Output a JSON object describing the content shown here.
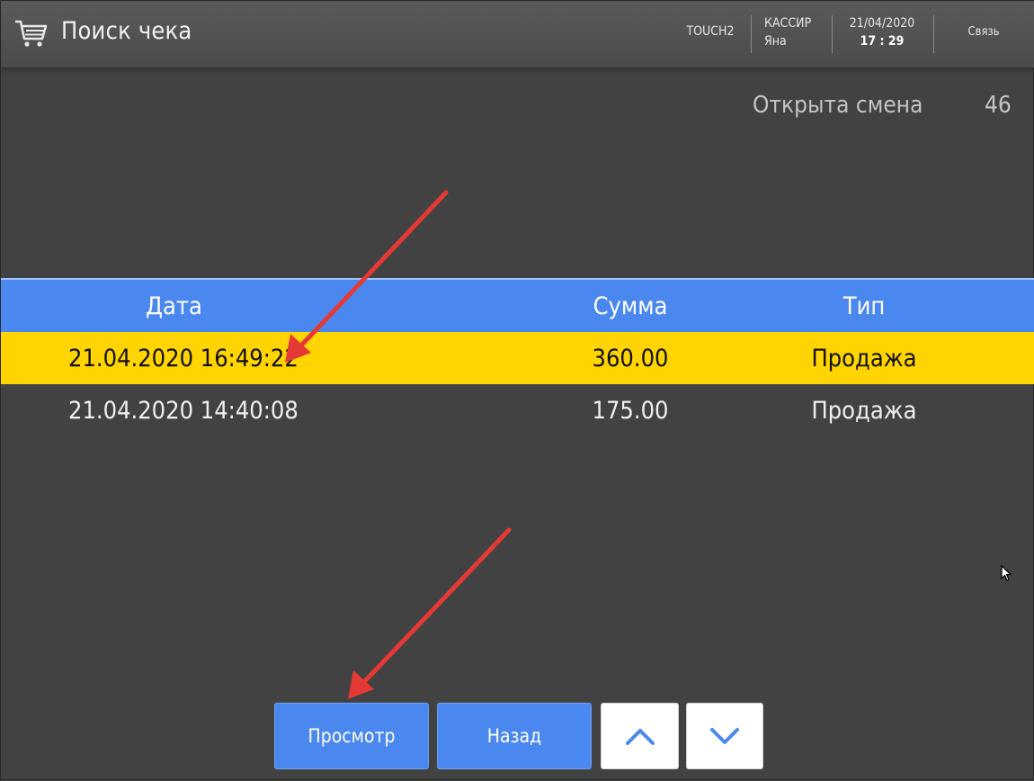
{
  "header": {
    "title": "Поиск чека",
    "station": "TOUCH2",
    "cashier_role": "КАССИР",
    "cashier_name": "Яна",
    "date": "21/04/2020",
    "time": "17 : 29",
    "link_label": "Связь"
  },
  "shift": {
    "label": "Открыта смена",
    "number": "46"
  },
  "table": {
    "columns": [
      "Дата",
      "Сумма",
      "Тип"
    ],
    "rows": [
      {
        "date": "21.04.2020 16:49:22",
        "sum": "360.00",
        "type": "Продажа",
        "selected": true
      },
      {
        "date": "21.04.2020 14:40:08",
        "sum": "175.00",
        "type": "Продажа",
        "selected": false
      }
    ]
  },
  "buttons": {
    "view": "Просмотр",
    "back": "Назад",
    "up_icon": "chevron-up-icon",
    "down_icon": "chevron-down-icon"
  },
  "colors": {
    "header_bg": "#505050",
    "background": "#424242",
    "accent_blue": "#4a88ef",
    "selected_row": "#ffd400",
    "annotation_arrow": "#e53935"
  }
}
